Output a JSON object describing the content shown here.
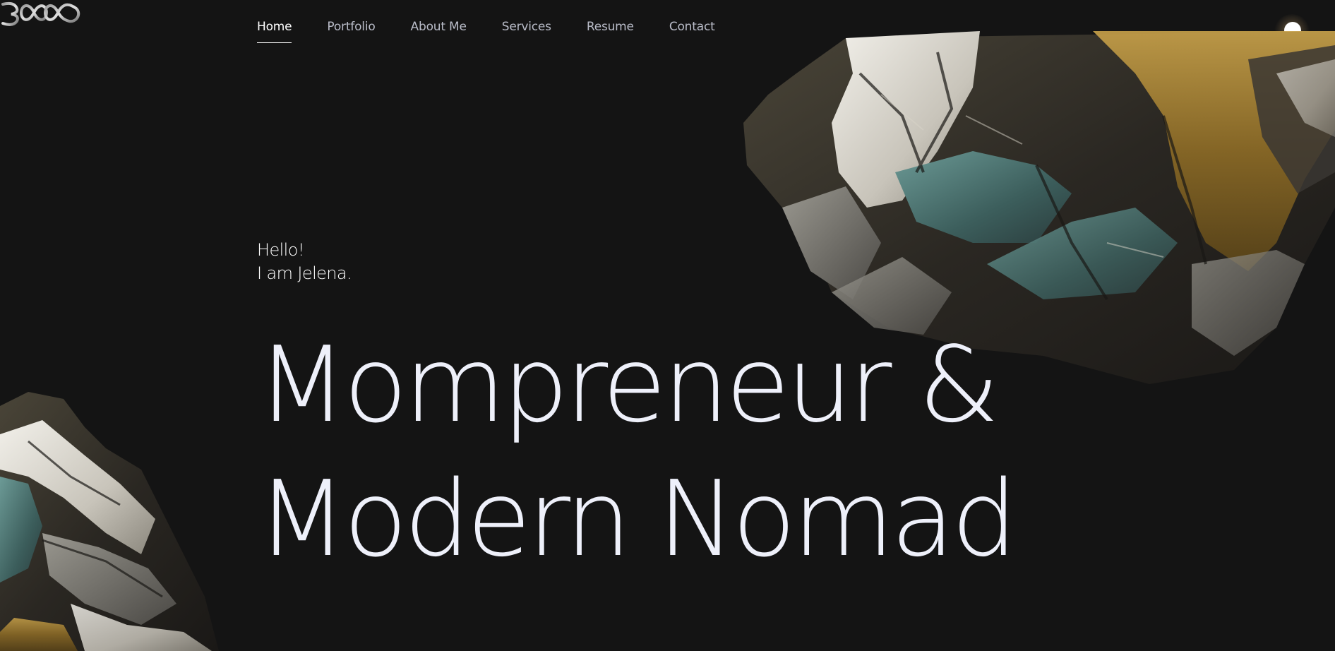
{
  "brand": {
    "logo_text": "3∞"
  },
  "nav": {
    "items": [
      {
        "label": "Home",
        "active": true
      },
      {
        "label": "Portfolio",
        "active": false
      },
      {
        "label": "About Me",
        "active": false
      },
      {
        "label": "Services",
        "active": false
      },
      {
        "label": "Resume",
        "active": false
      },
      {
        "label": "Contact",
        "active": false
      }
    ]
  },
  "hero": {
    "greeting": "Hello!",
    "intro": "I am Jelena.",
    "headline_line1": "Mompreneur &",
    "headline_line2": "Modern Nomad"
  },
  "theme_toggle": {
    "icon": "sun-toggle-icon"
  },
  "colors": {
    "background": "#141414",
    "text_primary": "#ffffff",
    "text_nav": "#b9bcc8",
    "rock_gold": "#b08a3a",
    "rock_teal": "#4d7a7a"
  }
}
